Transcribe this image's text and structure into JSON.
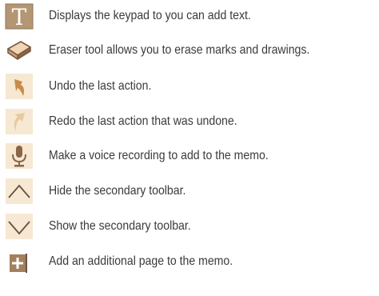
{
  "rows": [
    {
      "icon": "text-tool-icon",
      "text": "Displays the keypad to you can add text."
    },
    {
      "icon": "eraser-icon",
      "text": "Eraser tool allows you to erase marks and drawings."
    },
    {
      "icon": "undo-icon",
      "text": "Undo the last action."
    },
    {
      "icon": "redo-icon",
      "text": "Redo the last action that was undone."
    },
    {
      "icon": "microphone-icon",
      "text": "Make a voice recording to add to the memo."
    },
    {
      "icon": "chevron-up-icon",
      "text": "Hide the secondary toolbar."
    },
    {
      "icon": "chevron-down-icon",
      "text": "Show the secondary toolbar."
    },
    {
      "icon": "add-page-icon",
      "text": "Add an additional page to the memo."
    }
  ]
}
